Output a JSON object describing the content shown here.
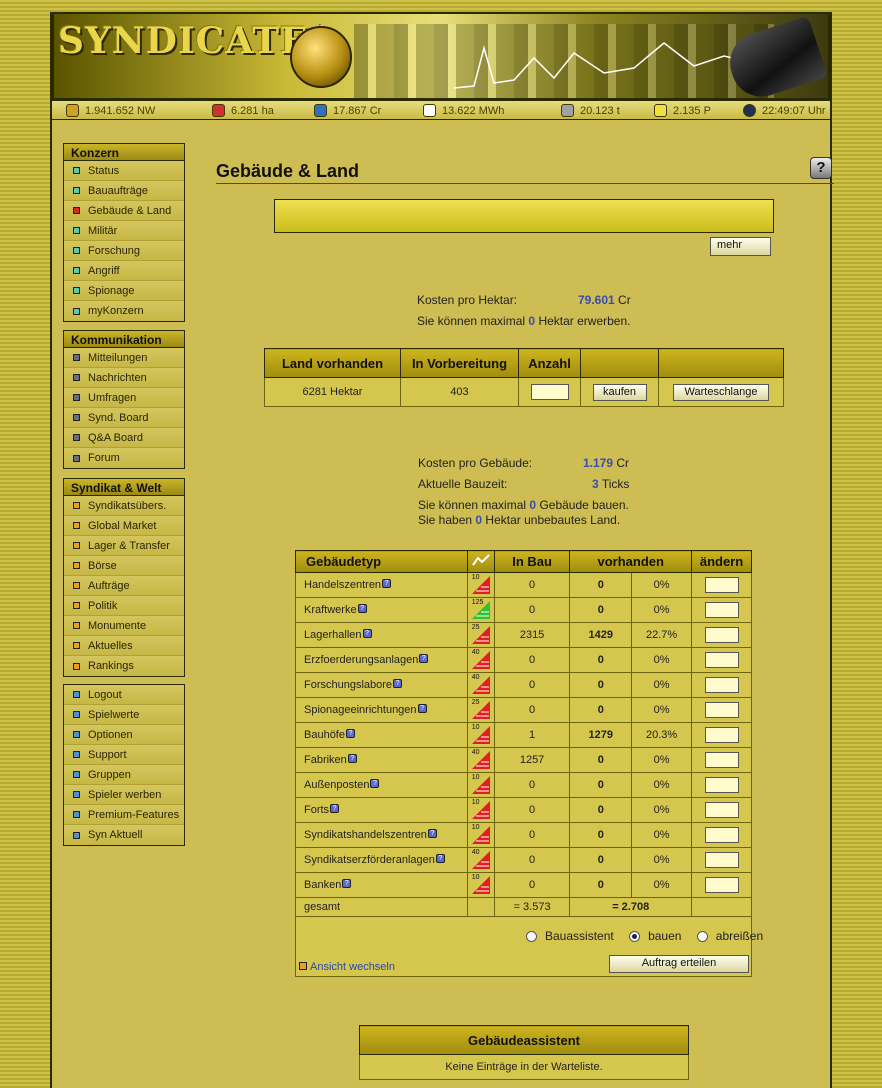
{
  "banner": {
    "logo": "SYNDICATE$"
  },
  "status": [
    {
      "icon": "networth-icon",
      "text": "1.941.652 NW",
      "color": "#d0a020"
    },
    {
      "icon": "land-icon",
      "text": "6.281 ha",
      "color": "#d03030"
    },
    {
      "icon": "credits-icon",
      "text": "17.867 Cr",
      "color": "#3070c0"
    },
    {
      "icon": "energy-icon",
      "text": "13.622 MWh",
      "color": "#ffffff"
    },
    {
      "icon": "ore-icon",
      "text": "20.123 t",
      "color": "#a0a0a0"
    },
    {
      "icon": "research-icon",
      "text": "2.135 P",
      "color": "#f0e040"
    },
    {
      "icon": "clock-icon",
      "text": "22:49:07 Uhr",
      "color": "#203050"
    }
  ],
  "menus": [
    {
      "title": "Konzern",
      "color": "#5ec8b0",
      "items": [
        "Status",
        "Bauaufträge",
        "Gebäude & Land",
        "Militär",
        "Forschung",
        "Angriff",
        "Spionage",
        "myKonzern"
      ]
    },
    {
      "title": "Kommunikation",
      "color": "#6a6a80",
      "items": [
        "Mitteilungen",
        "Nachrichten",
        "Umfragen",
        "Synd. Board",
        "Q&A Board",
        "Forum"
      ]
    },
    {
      "title": "Syndikat & Welt",
      "color": "#e8a020",
      "items": [
        "Syndikatsübers.",
        "Global Market",
        "Lager & Transfer",
        "Börse",
        "Aufträge",
        "Politik",
        "Monumente",
        "Aktuelles",
        "Rankings"
      ]
    },
    {
      "title": "",
      "color": "#5090d0",
      "items": [
        "Logout",
        "Spielwerte",
        "Optionen",
        "Support",
        "Gruppen",
        "Spieler werben",
        "Premium-Features",
        "Syn Aktuell"
      ]
    }
  ],
  "active_menu_color": "#d03020",
  "page": {
    "title": "Gebäude & Land",
    "help": "?",
    "more_button": "mehr"
  },
  "land": {
    "cost_label": "Kosten pro Hektar:",
    "cost_value": "79.601",
    "cost_unit": "Cr",
    "max_prefix": "Sie können maximal",
    "max_value": "0",
    "max_suffix": "Hektar erwerben.",
    "headers": [
      "Land vorhanden",
      "In Vorbereitung",
      "Anzahl",
      "",
      ""
    ],
    "row": {
      "available": "6281 Hektar",
      "preparing": "403",
      "buy_button": "kaufen",
      "queue_button": "Warteschlange"
    }
  },
  "buildings": {
    "cost_label": "Kosten pro Gebäude:",
    "cost_value": "1.179",
    "cost_unit": "Cr",
    "time_label": "Aktuelle Bauzeit:",
    "time_value": "3",
    "time_unit": "Ticks",
    "max_prefix": "Sie können maximal",
    "max_value": "0",
    "max_suffix": "Gebäude bauen.",
    "free_prefix": "Sie haben",
    "free_value": "0",
    "free_suffix": "Hektar unbebautes Land.",
    "headers": [
      "Gebäudetyp",
      "In Bau",
      "vorhanden",
      "ändern"
    ],
    "rows": [
      {
        "name": "Handelszentren",
        "level": "10",
        "trend": "down",
        "inbau": "0",
        "count": "0",
        "pct": "0%"
      },
      {
        "name": "Kraftwerke",
        "level": "125",
        "trend": "up",
        "inbau": "0",
        "count": "0",
        "pct": "0%"
      },
      {
        "name": "Lagerhallen",
        "level": "25",
        "trend": "down",
        "inbau": "2315",
        "count": "1429",
        "pct": "22.7%"
      },
      {
        "name": "Erzfoerderungsanlagen",
        "level": "40",
        "trend": "down",
        "inbau": "0",
        "count": "0",
        "pct": "0%"
      },
      {
        "name": "Forschungslabore",
        "level": "40",
        "trend": "down",
        "inbau": "0",
        "count": "0",
        "pct": "0%"
      },
      {
        "name": "Spionageeinrichtungen",
        "level": "25",
        "trend": "down",
        "inbau": "0",
        "count": "0",
        "pct": "0%"
      },
      {
        "name": "Bauhöfe",
        "level": "10",
        "trend": "down",
        "inbau": "1",
        "count": "1279",
        "pct": "20.3%"
      },
      {
        "name": "Fabriken",
        "level": "40",
        "trend": "down",
        "inbau": "1257",
        "count": "0",
        "pct": "0%"
      },
      {
        "name": "Außenposten",
        "level": "10",
        "trend": "down",
        "inbau": "0",
        "count": "0",
        "pct": "0%"
      },
      {
        "name": "Forts",
        "level": "10",
        "trend": "down",
        "inbau": "0",
        "count": "0",
        "pct": "0%"
      },
      {
        "name": "Syndikatshandelszentren",
        "level": "10",
        "trend": "down",
        "inbau": "0",
        "count": "0",
        "pct": "0%"
      },
      {
        "name": "Syndikatserzförderanlagen",
        "level": "40",
        "trend": "down",
        "inbau": "0",
        "count": "0",
        "pct": "0%"
      },
      {
        "name": "Banken",
        "level": "10",
        "trend": "down",
        "inbau": "0",
        "count": "0",
        "pct": "0%"
      }
    ],
    "total": {
      "label": "gesamt",
      "inbau": "= 3.573",
      "count": "= 2.708"
    },
    "options": [
      "Bauassistent",
      "bauen",
      "abreißen"
    ],
    "selected_option": "bauen",
    "toggle_view": "Ansicht wechseln",
    "submit_button": "Auftrag erteilen"
  },
  "assistant": {
    "title": "Gebäudeassistent",
    "message": "Keine Einträge in der Warteliste."
  }
}
